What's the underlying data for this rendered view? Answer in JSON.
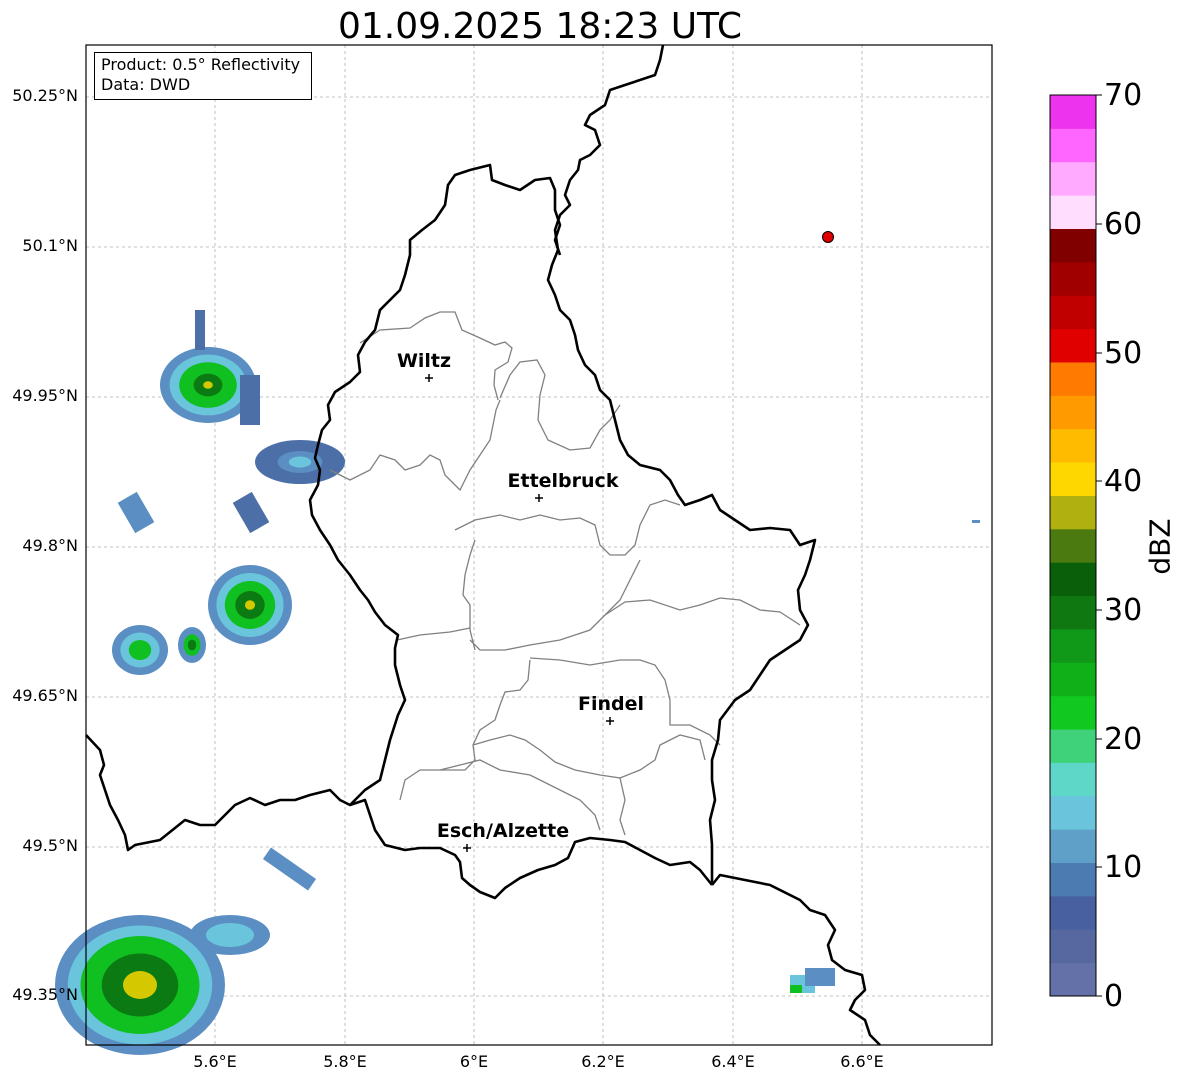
{
  "title": "01.09.2025 18:23 UTC",
  "info": {
    "product": "Product: 0.5° Reflectivity",
    "data": "Data: DWD"
  },
  "axes": {
    "lat_labels": [
      "50.25°N",
      "50.1°N",
      "49.95°N",
      "49.8°N",
      "49.65°N",
      "49.5°N",
      "49.35°N"
    ],
    "lon_labels": [
      "5.6°E",
      "5.8°E",
      "6°E",
      "6.2°E",
      "6.4°E",
      "6.6°E"
    ]
  },
  "cities": [
    {
      "name": "Wiltz",
      "lon": 5.93,
      "lat": 49.965
    },
    {
      "name": "Ettelbruck",
      "lon": 6.1,
      "lat": 49.85
    },
    {
      "name": "Findel",
      "lon": 6.21,
      "lat": 49.627
    },
    {
      "name": "Esch/Alzette",
      "lon": 5.99,
      "lat": 49.498
    }
  ],
  "radar_site": {
    "lon": 6.548,
    "lat": 50.11,
    "color": "#e00000"
  },
  "colorbar": {
    "label": "dBZ",
    "ticks": [
      "70",
      "60",
      "50",
      "40",
      "30",
      "20",
      "10",
      "0"
    ],
    "colors": [
      "#6471a8",
      "#56689f",
      "#4860a0",
      "#4c7bb2",
      "#5ea0c8",
      "#6ac4dc",
      "#5ed6c8",
      "#40d27a",
      "#10c820",
      "#10b018",
      "#109818",
      "#107810",
      "#0a600a",
      "#4a7a10",
      "#b0b010",
      "#ffd700",
      "#ffbb00",
      "#ff9a00",
      "#ff7a00",
      "#e00000",
      "#c00000",
      "#a00000",
      "#800000",
      "#ffddff",
      "#ffaaff",
      "#ff66ff",
      "#ee33ee"
    ]
  },
  "echo_colors": {
    "light": "#5b8ec2",
    "blue": "#4d6fa8",
    "cyan": "#6ac4dc",
    "green": "#10c020",
    "darkgreen": "#0b7a12",
    "yellow": "#d4c800"
  }
}
